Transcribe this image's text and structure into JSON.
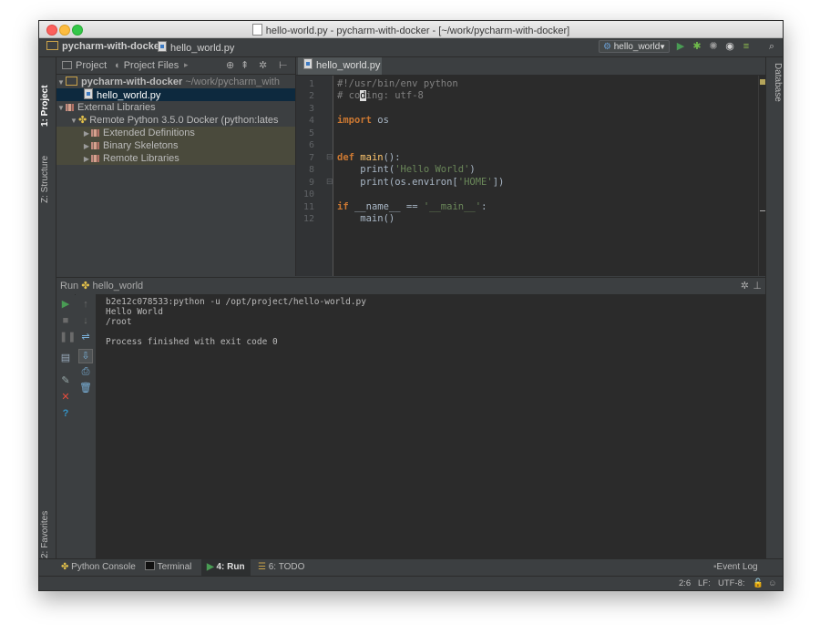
{
  "window": {
    "title": "hello-world.py - pycharm-with-docker - [~/work/pycharm-with-docker]"
  },
  "navbar": {
    "project": "pycharm-with-docker",
    "file": "hello_world.py",
    "run_config": "hello_world"
  },
  "left_strip": {
    "project_tab": "1: Project",
    "structure_tab": "Z: Structure",
    "favorites_tab": "2: Favorites"
  },
  "right_strip": {
    "database_tab": "Database"
  },
  "project_panel": {
    "tabs": [
      "Project",
      "Project Files"
    ],
    "tree": [
      {
        "label": "pycharm-with-docker",
        "suffix": "~/work/pycharm_with",
        "level": 0,
        "type": "folder",
        "expanded": true
      },
      {
        "label": "hello_world.py",
        "level": 1,
        "type": "pyfile",
        "selected": true
      },
      {
        "label": "External Libraries",
        "level": 0,
        "type": "lib",
        "expanded": true
      },
      {
        "label": "Remote Python 3.5.0 Docker",
        "suffix": "(python:lates",
        "level": 1,
        "type": "sdk",
        "expanded": true
      },
      {
        "label": "Extended Definitions",
        "level": 2,
        "type": "lib"
      },
      {
        "label": "Binary Skeletons",
        "level": 2,
        "type": "lib"
      },
      {
        "label": "Remote Libraries",
        "level": 2,
        "type": "lib"
      }
    ]
  },
  "editor": {
    "tab_label": "hello_world.py",
    "line_numbers": [
      "1",
      "2",
      "3",
      "4",
      "5",
      "6",
      "7",
      "8",
      "9",
      "10",
      "11",
      "12"
    ]
  },
  "run_panel": {
    "label": "Run",
    "config": "hello_world",
    "output": [
      "b2e12c078533:python -u /opt/project/hello-world.py",
      "Hello World",
      "/root",
      "",
      "Process finished with exit code 0"
    ]
  },
  "bottom_tabs": {
    "python_console": "Python Console",
    "terminal": "Terminal",
    "run": "4: Run",
    "todo": "6: TODO",
    "event_log": "Event Log"
  },
  "status": {
    "position": "2:6",
    "line_sep": "LF:",
    "encoding": "UTF-8:"
  },
  "colors": {
    "accent_green": "#499c54",
    "error_red": "#e74c3c",
    "help_blue": "#3592c4"
  }
}
